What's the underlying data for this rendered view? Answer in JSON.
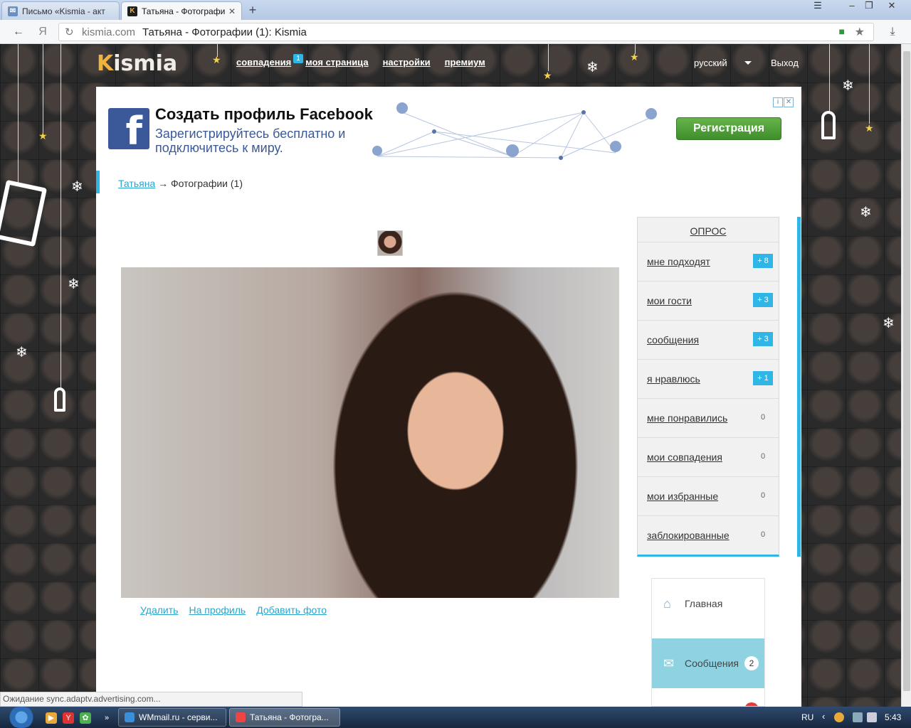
{
  "browser": {
    "tabs": [
      {
        "label": "Письмо «Kismia - акт",
        "icon": "mail-icon"
      },
      {
        "label": "Татьяна - Фотографи",
        "icon": "kismia-favicon"
      }
    ],
    "new_tab_symbol": "+",
    "address": {
      "domain": "kismia.com",
      "title": "Татьяна - Фотографии (1): Kismia"
    },
    "yandex_symbol": "Я",
    "status": "Ожидание sync.adaptv.advertising.com..."
  },
  "site": {
    "logo": {
      "k": "K",
      "rest": "ismia"
    },
    "nav": [
      {
        "label": "совпадения",
        "badge": "1"
      },
      {
        "label": "моя страница"
      },
      {
        "label": "настройки"
      },
      {
        "label": "премиум"
      }
    ],
    "language": "русский",
    "logout": "Выход"
  },
  "ad": {
    "fb_letter": "f",
    "title": "Создать профиль Facebook",
    "subtitle": "Зарегистрируйтесь бесплатно и подключитесь к миру.",
    "cta": "Регистрация"
  },
  "breadcrumb": {
    "link": "Татьяна",
    "arrow": "→",
    "current": "Фотографии (1)"
  },
  "photo_actions": {
    "delete": "Удалить",
    "profile": "На профиль",
    "add": "Добавить фото"
  },
  "poll": {
    "title": "ОПРОС",
    "items": [
      {
        "label": "мне подходят",
        "count": "+ 8",
        "highlight": true
      },
      {
        "label": "мои гости",
        "count": "+ 3",
        "highlight": true
      },
      {
        "label": "сообщения",
        "count": "+ 3",
        "highlight": true
      },
      {
        "label": "я нравлюсь",
        "count": "+ 1",
        "highlight": true
      },
      {
        "label": "мне понравились",
        "count": "0",
        "highlight": false
      },
      {
        "label": "мои совпадения",
        "count": "0",
        "highlight": false
      },
      {
        "label": "мои избранные",
        "count": "0",
        "highlight": false
      },
      {
        "label": "заблокированные",
        "count": "0",
        "highlight": false
      }
    ]
  },
  "mini_nav": {
    "home": "Главная",
    "messages": "Сообщения",
    "messages_badge": "2"
  },
  "taskbar": {
    "tasks": [
      {
        "label": "WMmail.ru - серви..."
      },
      {
        "label": "Татьяна - Фотогра..."
      }
    ],
    "lang": "RU",
    "clock": "5:43"
  },
  "colors": {
    "accent": "#2fb6e6",
    "facebook": "#3b5998",
    "cta_green": "#4e9f37",
    "logo_orange": "#f2b33d"
  }
}
